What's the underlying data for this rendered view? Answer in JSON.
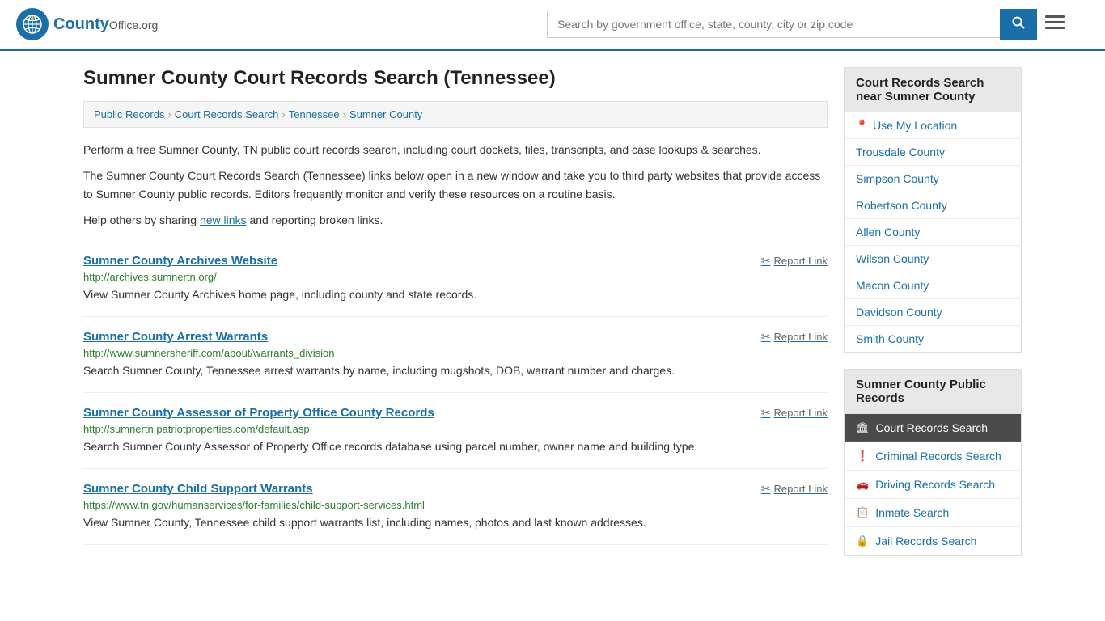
{
  "header": {
    "logo_text": "County",
    "logo_suffix": "Office.org",
    "search_placeholder": "Search by government office, state, county, city or zip code",
    "search_button_label": "🔍"
  },
  "page": {
    "title": "Sumner County Court Records Search (Tennessee)"
  },
  "breadcrumb": {
    "items": [
      {
        "label": "Public Records",
        "href": "#"
      },
      {
        "label": "Court Records Search",
        "href": "#"
      },
      {
        "label": "Tennessee",
        "href": "#"
      },
      {
        "label": "Sumner County",
        "href": "#"
      }
    ]
  },
  "description": {
    "para1": "Perform a free Sumner County, TN public court records search, including court dockets, files, transcripts, and case lookups & searches.",
    "para2": "The Sumner County Court Records Search (Tennessee) links below open in a new window and take you to third party websites that provide access to Sumner County public records. Editors frequently monitor and verify these resources on a routine basis.",
    "para3_prefix": "Help others by sharing ",
    "new_links_text": "new links",
    "para3_suffix": " and reporting broken links."
  },
  "results": [
    {
      "title": "Sumner County Archives Website",
      "url": "http://archives.sumnertn.org/",
      "desc": "View Sumner County Archives home page, including county and state records.",
      "report_label": "Report Link"
    },
    {
      "title": "Sumner County Arrest Warrants",
      "url": "http://www.sumnersheriff.com/about/warrants_division",
      "desc": "Search Sumner County, Tennessee arrest warrants by name, including mugshots, DOB, warrant number and charges.",
      "report_label": "Report Link"
    },
    {
      "title": "Sumner County Assessor of Property Office County Records",
      "url": "http://sumnertn.patriotproperties.com/default.asp",
      "desc": "Search Sumner County Assessor of Property Office records database using parcel number, owner name and building type.",
      "report_label": "Report Link"
    },
    {
      "title": "Sumner County Child Support Warrants",
      "url": "https://www.tn.gov/humanservices/for-families/child-support-services.html",
      "desc": "View Sumner County, Tennessee child support warrants list, including names, photos and last known addresses.",
      "report_label": "Report Link"
    }
  ],
  "sidebar": {
    "nearby_header": "Court Records Search near Sumner County",
    "use_my_location": "Use My Location",
    "nearby_counties": [
      {
        "name": "Trousdale County"
      },
      {
        "name": "Simpson County"
      },
      {
        "name": "Robertson County"
      },
      {
        "name": "Allen County"
      },
      {
        "name": "Wilson County"
      },
      {
        "name": "Macon County"
      },
      {
        "name": "Davidson County"
      },
      {
        "name": "Smith County"
      }
    ],
    "public_records_header": "Sumner County Public Records",
    "public_records_items": [
      {
        "label": "Court Records Search",
        "active": true,
        "icon": "🏛"
      },
      {
        "label": "Criminal Records Search",
        "active": false,
        "icon": "❗"
      },
      {
        "label": "Driving Records Search",
        "active": false,
        "icon": "🚗"
      },
      {
        "label": "Inmate Search",
        "active": false,
        "icon": "📋"
      },
      {
        "label": "Jail Records Search",
        "active": false,
        "icon": "🔒"
      }
    ]
  }
}
